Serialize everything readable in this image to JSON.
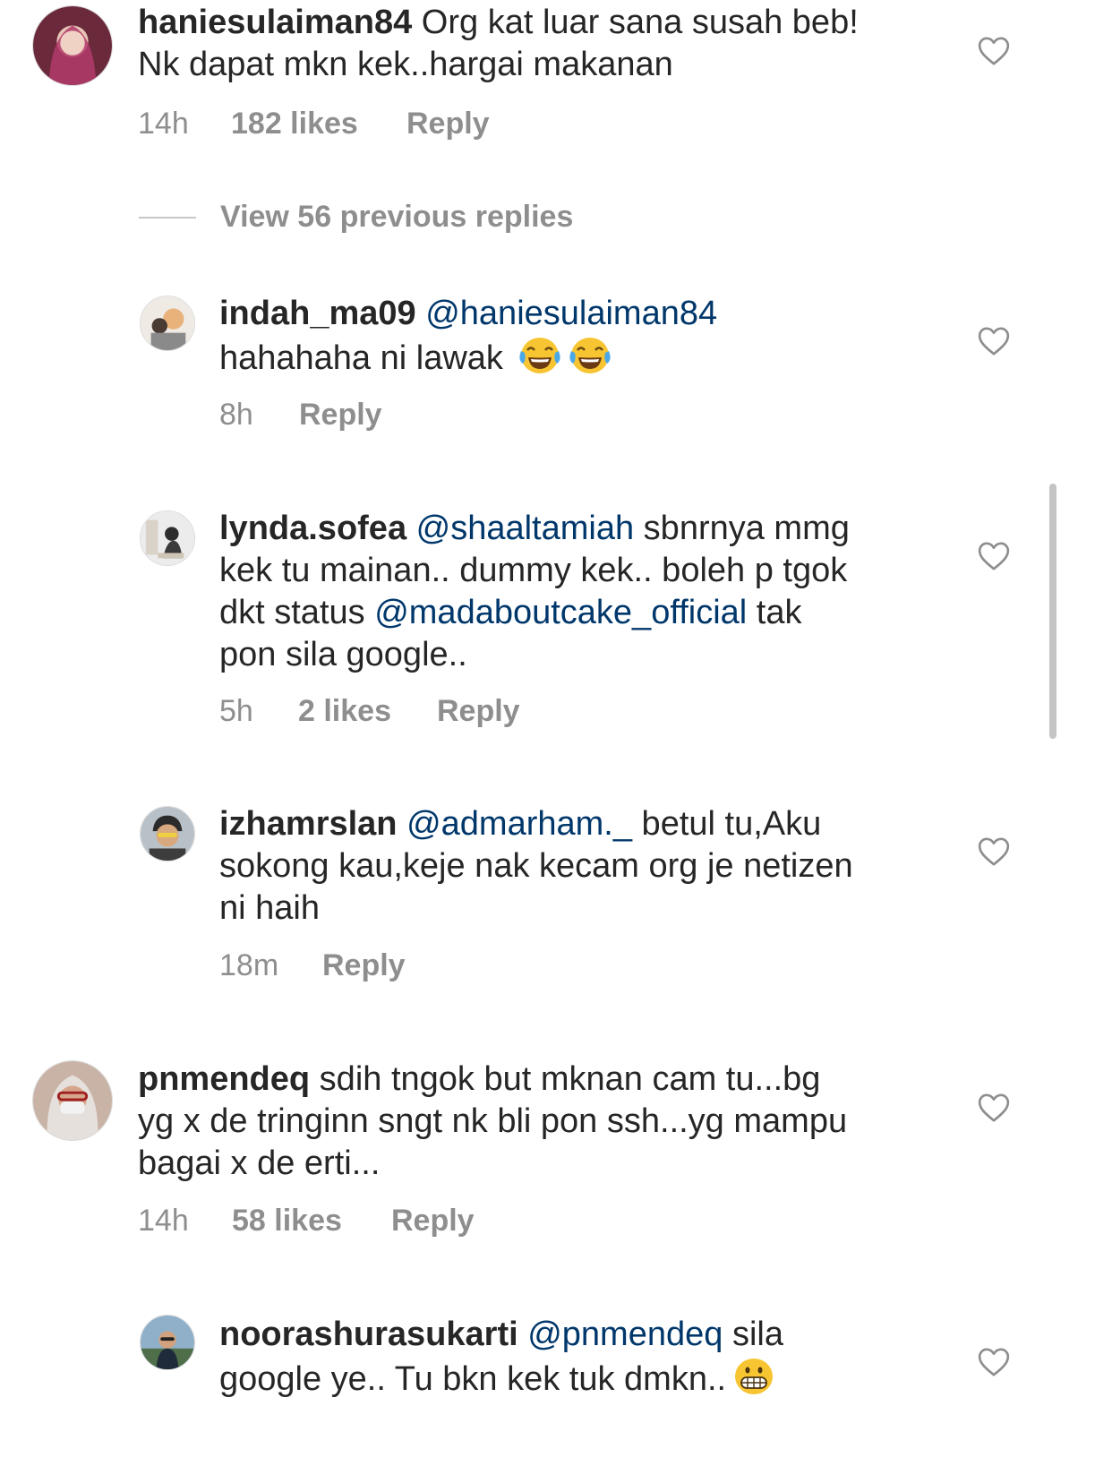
{
  "comments": [
    {
      "username": "haniesulaiman84",
      "lines": [
        [
          {
            "t": "haniesulaiman84",
            "k": "user"
          },
          {
            "t": " Org kat luar sana susah beb!",
            "k": "text"
          }
        ],
        [
          {
            "t": "Nk dapat mkn kek..hargai makanan",
            "k": "text"
          }
        ]
      ],
      "time": "14h",
      "likes": "182 likes",
      "reply": "Reply"
    },
    {
      "username": "indah_ma09",
      "lines": [
        [
          {
            "t": "indah_ma09",
            "k": "user"
          },
          {
            "t": " ",
            "k": "text"
          },
          {
            "t": "@haniesulaiman84",
            "k": "mention"
          }
        ],
        [
          {
            "t": "hahahaha ni lawak ",
            "k": "text"
          }
        ]
      ],
      "emoji": [
        "face-with-tears-of-joy-emoji",
        "face-with-tears-of-joy-emoji"
      ],
      "time": "8h",
      "likes": "",
      "reply": "Reply"
    },
    {
      "username": "lynda.sofea",
      "lines": [
        [
          {
            "t": "lynda.sofea",
            "k": "user"
          },
          {
            "t": " ",
            "k": "text"
          },
          {
            "t": "@shaaltamiah",
            "k": "mention"
          },
          {
            "t": " sbnrnya mmg",
            "k": "text"
          }
        ],
        [
          {
            "t": "kek tu mainan.. dummy kek.. boleh p tgok",
            "k": "text"
          }
        ],
        [
          {
            "t": "dkt status ",
            "k": "text"
          },
          {
            "t": "@madaboutcake_official",
            "k": "mention"
          },
          {
            "t": " tak",
            "k": "text"
          }
        ],
        [
          {
            "t": "pon sila google..",
            "k": "text"
          }
        ]
      ],
      "time": "5h",
      "likes": "2 likes",
      "reply": "Reply"
    },
    {
      "username": "izhamrslan",
      "lines": [
        [
          {
            "t": "izhamrslan",
            "k": "user"
          },
          {
            "t": " ",
            "k": "text"
          },
          {
            "t": "@admarham._",
            "k": "mention"
          },
          {
            "t": " betul tu,Aku",
            "k": "text"
          }
        ],
        [
          {
            "t": "sokong kau,keje nak kecam org je netizen",
            "k": "text"
          }
        ],
        [
          {
            "t": "ni haih",
            "k": "text"
          }
        ]
      ],
      "time": "18m",
      "likes": "",
      "reply": "Reply"
    },
    {
      "username": "pnmendeq",
      "lines": [
        [
          {
            "t": "pnmendeq",
            "k": "user"
          },
          {
            "t": " sdih tngok but mknan cam tu...bg",
            "k": "text"
          }
        ],
        [
          {
            "t": "yg x de tringinn sngt nk bli pon ssh...yg mampu",
            "k": "text"
          }
        ],
        [
          {
            "t": "bagai x de erti...",
            "k": "text"
          }
        ]
      ],
      "time": "14h",
      "likes": "58 likes",
      "reply": "Reply"
    },
    {
      "username": "noorashurasukarti",
      "lines": [
        [
          {
            "t": "noorashurasukarti",
            "k": "user"
          },
          {
            "t": " ",
            "k": "text"
          },
          {
            "t": "@pnmendeq",
            "k": "mention"
          },
          {
            "t": " sila",
            "k": "text"
          }
        ],
        [
          {
            "t": "google ye.. Tu bkn kek tuk dmkn..",
            "k": "text"
          }
        ]
      ],
      "emoji": [
        "grimacing-face-emoji"
      ],
      "time": "",
      "likes": "",
      "reply": ""
    }
  ],
  "view_replies": "View 56 previous replies",
  "colors": {
    "text": "#262626",
    "secondary": "#8e8e8e",
    "mention": "#00376b",
    "divider": "#c7c7c7"
  },
  "icons": {
    "like": "heart-outline-icon"
  }
}
